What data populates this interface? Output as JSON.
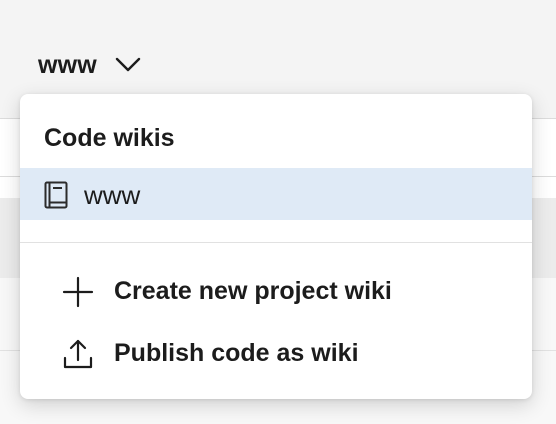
{
  "picker": {
    "selected_wiki": "www",
    "chevron_icon": "chevron-down-icon"
  },
  "menu": {
    "heading": "Code wikis",
    "wikis": [
      {
        "label": "www",
        "icon": "book-icon",
        "selected": true
      }
    ],
    "actions": [
      {
        "label": "Create new project wiki",
        "icon": "plus-icon"
      },
      {
        "label": "Publish code as wiki",
        "icon": "upload-icon"
      }
    ]
  },
  "colors": {
    "selected_item_bg": "#dfeaf6",
    "text": "#1c1c1c",
    "menu_bg": "#ffffff"
  }
}
